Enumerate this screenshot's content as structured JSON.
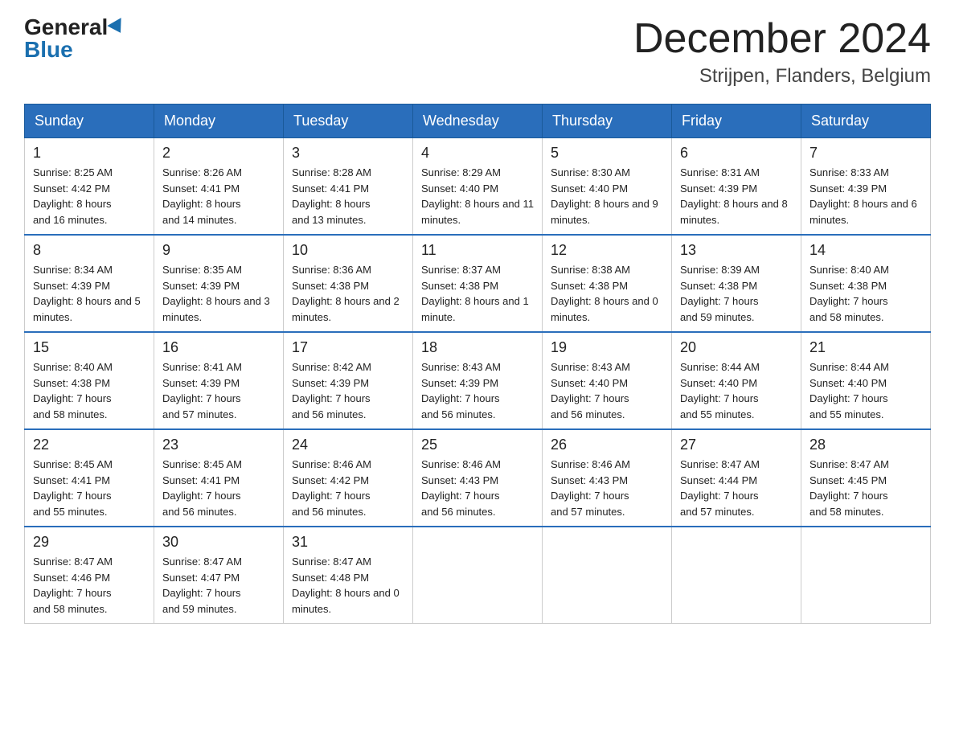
{
  "logo": {
    "general": "General",
    "blue": "Blue"
  },
  "title": "December 2024",
  "location": "Strijpen, Flanders, Belgium",
  "headers": [
    "Sunday",
    "Monday",
    "Tuesday",
    "Wednesday",
    "Thursday",
    "Friday",
    "Saturday"
  ],
  "weeks": [
    [
      {
        "day": "1",
        "sunrise": "8:25 AM",
        "sunset": "4:42 PM",
        "daylight": "8 hours and 16 minutes."
      },
      {
        "day": "2",
        "sunrise": "8:26 AM",
        "sunset": "4:41 PM",
        "daylight": "8 hours and 14 minutes."
      },
      {
        "day": "3",
        "sunrise": "8:28 AM",
        "sunset": "4:41 PM",
        "daylight": "8 hours and 13 minutes."
      },
      {
        "day": "4",
        "sunrise": "8:29 AM",
        "sunset": "4:40 PM",
        "daylight": "8 hours and 11 minutes."
      },
      {
        "day": "5",
        "sunrise": "8:30 AM",
        "sunset": "4:40 PM",
        "daylight": "8 hours and 9 minutes."
      },
      {
        "day": "6",
        "sunrise": "8:31 AM",
        "sunset": "4:39 PM",
        "daylight": "8 hours and 8 minutes."
      },
      {
        "day": "7",
        "sunrise": "8:33 AM",
        "sunset": "4:39 PM",
        "daylight": "8 hours and 6 minutes."
      }
    ],
    [
      {
        "day": "8",
        "sunrise": "8:34 AM",
        "sunset": "4:39 PM",
        "daylight": "8 hours and 5 minutes."
      },
      {
        "day": "9",
        "sunrise": "8:35 AM",
        "sunset": "4:39 PM",
        "daylight": "8 hours and 3 minutes."
      },
      {
        "day": "10",
        "sunrise": "8:36 AM",
        "sunset": "4:38 PM",
        "daylight": "8 hours and 2 minutes."
      },
      {
        "day": "11",
        "sunrise": "8:37 AM",
        "sunset": "4:38 PM",
        "daylight": "8 hours and 1 minute."
      },
      {
        "day": "12",
        "sunrise": "8:38 AM",
        "sunset": "4:38 PM",
        "daylight": "8 hours and 0 minutes."
      },
      {
        "day": "13",
        "sunrise": "8:39 AM",
        "sunset": "4:38 PM",
        "daylight": "7 hours and 59 minutes."
      },
      {
        "day": "14",
        "sunrise": "8:40 AM",
        "sunset": "4:38 PM",
        "daylight": "7 hours and 58 minutes."
      }
    ],
    [
      {
        "day": "15",
        "sunrise": "8:40 AM",
        "sunset": "4:38 PM",
        "daylight": "7 hours and 58 minutes."
      },
      {
        "day": "16",
        "sunrise": "8:41 AM",
        "sunset": "4:39 PM",
        "daylight": "7 hours and 57 minutes."
      },
      {
        "day": "17",
        "sunrise": "8:42 AM",
        "sunset": "4:39 PM",
        "daylight": "7 hours and 56 minutes."
      },
      {
        "day": "18",
        "sunrise": "8:43 AM",
        "sunset": "4:39 PM",
        "daylight": "7 hours and 56 minutes."
      },
      {
        "day": "19",
        "sunrise": "8:43 AM",
        "sunset": "4:40 PM",
        "daylight": "7 hours and 56 minutes."
      },
      {
        "day": "20",
        "sunrise": "8:44 AM",
        "sunset": "4:40 PM",
        "daylight": "7 hours and 55 minutes."
      },
      {
        "day": "21",
        "sunrise": "8:44 AM",
        "sunset": "4:40 PM",
        "daylight": "7 hours and 55 minutes."
      }
    ],
    [
      {
        "day": "22",
        "sunrise": "8:45 AM",
        "sunset": "4:41 PM",
        "daylight": "7 hours and 55 minutes."
      },
      {
        "day": "23",
        "sunrise": "8:45 AM",
        "sunset": "4:41 PM",
        "daylight": "7 hours and 56 minutes."
      },
      {
        "day": "24",
        "sunrise": "8:46 AM",
        "sunset": "4:42 PM",
        "daylight": "7 hours and 56 minutes."
      },
      {
        "day": "25",
        "sunrise": "8:46 AM",
        "sunset": "4:43 PM",
        "daylight": "7 hours and 56 minutes."
      },
      {
        "day": "26",
        "sunrise": "8:46 AM",
        "sunset": "4:43 PM",
        "daylight": "7 hours and 57 minutes."
      },
      {
        "day": "27",
        "sunrise": "8:47 AM",
        "sunset": "4:44 PM",
        "daylight": "7 hours and 57 minutes."
      },
      {
        "day": "28",
        "sunrise": "8:47 AM",
        "sunset": "4:45 PM",
        "daylight": "7 hours and 58 minutes."
      }
    ],
    [
      {
        "day": "29",
        "sunrise": "8:47 AM",
        "sunset": "4:46 PM",
        "daylight": "7 hours and 58 minutes."
      },
      {
        "day": "30",
        "sunrise": "8:47 AM",
        "sunset": "4:47 PM",
        "daylight": "7 hours and 59 minutes."
      },
      {
        "day": "31",
        "sunrise": "8:47 AM",
        "sunset": "4:48 PM",
        "daylight": "8 hours and 0 minutes."
      },
      null,
      null,
      null,
      null
    ]
  ],
  "labels": {
    "sunrise": "Sunrise:",
    "sunset": "Sunset:",
    "daylight": "Daylight:"
  }
}
